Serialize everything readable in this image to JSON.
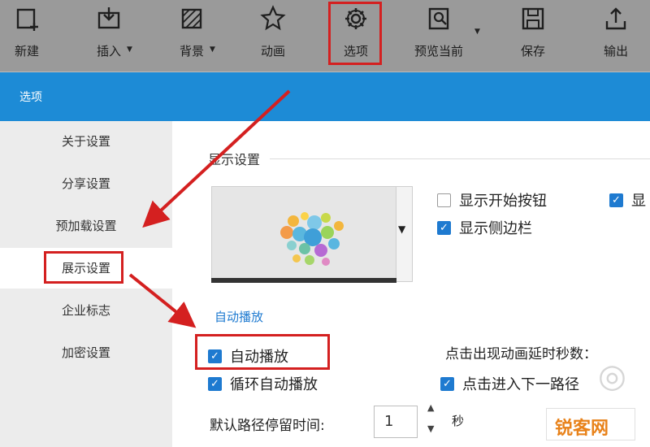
{
  "toolbar": {
    "buttons": [
      {
        "label": "新建",
        "icon": "new-page-icon"
      },
      {
        "label": "插入",
        "icon": "insert-icon"
      },
      {
        "label": "背景",
        "icon": "background-icon"
      },
      {
        "label": "动画",
        "icon": "animation-star-icon"
      },
      {
        "label": "选项",
        "icon": "gear-icon"
      },
      {
        "label": "预览当前",
        "icon": "preview-icon"
      },
      {
        "label": "保存",
        "icon": "save-disk-icon"
      },
      {
        "label": "输出",
        "icon": "export-upload-icon"
      }
    ]
  },
  "dialog": {
    "title": "选项",
    "sidebar": [
      {
        "label": "关于设置"
      },
      {
        "label": "分享设置"
      },
      {
        "label": "预加载设置"
      },
      {
        "label": "展示设置"
      },
      {
        "label": "企业标志"
      },
      {
        "label": "加密设置"
      }
    ],
    "display": {
      "section_title": "显示设置",
      "show_start_button": {
        "label": "显示开始按钮",
        "checked": false
      },
      "show_partial": {
        "label": "显",
        "checked": true
      },
      "show_sidebar": {
        "label": "显示侧边栏",
        "checked": true
      }
    },
    "autoplay": {
      "section_title": "自动播放",
      "auto_play": {
        "label": "自动播放",
        "checked": true
      },
      "loop_auto_play": {
        "label": "循环自动播放",
        "checked": true
      },
      "click_label": "点击出现动画延时秒数：",
      "click_next": {
        "label": "点击进入下一路径",
        "checked": true
      },
      "dwell_label": "默认路径停留时间:",
      "dwell_value": "1",
      "dwell_unit": "秒"
    }
  },
  "watermark": {
    "text": "锐客网"
  },
  "colors": {
    "accent": "#1e7ad0",
    "titlebar": "#1d8bd6",
    "annotation": "#d42020"
  }
}
